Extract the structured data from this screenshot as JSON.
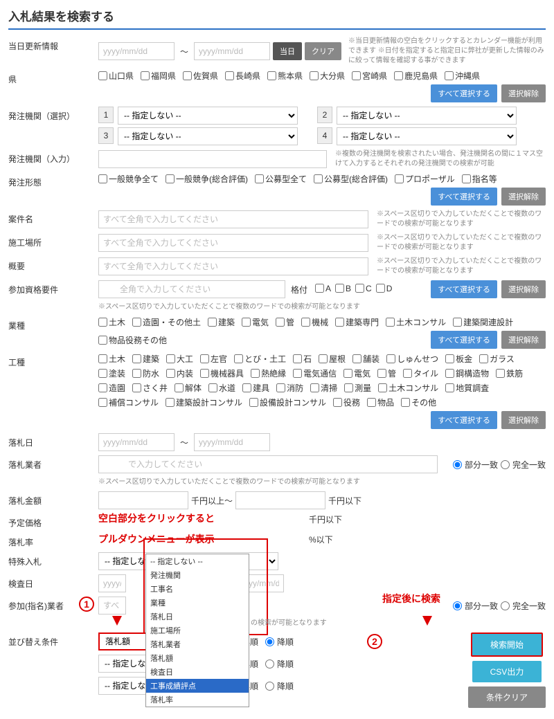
{
  "title": "入札結果を検索する",
  "rows": {
    "update": {
      "label": "当日更新情報",
      "placeholder": "yyyy/mm/dd",
      "btn_today": "当日",
      "btn_clear": "クリア",
      "note": "※当日更新情報の空白をクリックするとカレンダー機能が利用できます\n※日付を指定すると指定日に弊社が更新した情報のみに絞って情報を確認する事ができます"
    },
    "pref": {
      "label": "県",
      "items": [
        "山口県",
        "福岡県",
        "佐賀県",
        "長崎県",
        "熊本県",
        "大分県",
        "宮崎県",
        "鹿児島県",
        "沖縄県"
      ],
      "btn_all": "すべて選択する",
      "btn_clear": "選択解除"
    },
    "org_sel": {
      "label": "発注機関（選択）",
      "placeholder": "-- 指定しない --",
      "nums": [
        "1",
        "2",
        "3",
        "4"
      ]
    },
    "org_input": {
      "label": "発注機関（入力）",
      "note": "※複数の発注機関を検索されたい場合、発注機関名の間に１マス空けて入力するとそれぞれの発注機関での検索が可能"
    },
    "bid_type": {
      "label": "発注形態",
      "items": [
        "一般競争全て",
        "一般競争(総合評価)",
        "公募型全て",
        "公募型(総合評価)",
        "プロポーザル",
        "指名等"
      ],
      "btn_all": "すべて選択する",
      "btn_clear": "選択解除"
    },
    "name": {
      "label": "案件名",
      "placeholder": "すべて全角で入力してください",
      "note": "※スペース区切りで入力していただくことで複数のワードでの検索が可能となります"
    },
    "place": {
      "label": "施工場所",
      "placeholder": "すべて全角で入力してください",
      "note": "※スペース区切りで入力していただくことで複数のワードでの検索が可能となります"
    },
    "summary": {
      "label": "概要",
      "placeholder": "すべて全角で入力してください",
      "note": "※スペース区切りで入力していただくことで複数のワードでの検索が可能となります"
    },
    "qual": {
      "label": "参加資格要件",
      "placeholder": "　　全角で入力してください",
      "grade_label": "格付",
      "grades": [
        "A",
        "B",
        "C",
        "D"
      ],
      "btn_all": "すべて選択する",
      "btn_clear": "選択解除",
      "note": "※スペース区切りで入力していただくことで複数のワードでの検索が可能となります"
    },
    "industry": {
      "label": "業種",
      "items": [
        "土木",
        "造園・その他土",
        "建築",
        "電気",
        "管",
        "機械",
        "建築専門",
        "土木コンサル",
        "建築関連設計",
        "物品役務その他"
      ],
      "btn_all": "すべて選択する",
      "btn_clear": "選択解除"
    },
    "work": {
      "label": "工種",
      "items": [
        "土木",
        "建築",
        "大工",
        "左官",
        "とび・土工",
        "石",
        "屋根",
        "舗装",
        "しゅんせつ",
        "板金",
        "ガラス",
        "塗装",
        "防水",
        "内装",
        "機械器具",
        "熱絶縁",
        "電気通信",
        "電気",
        "管",
        "タイル",
        "鋼構造物",
        "鉄筋",
        "造園",
        "さく井",
        "解体",
        "水道",
        "建具",
        "消防",
        "清掃",
        "測量",
        "土木コンサル",
        "地質調査",
        "補償コンサル",
        "建築設計コンサル",
        "設備設計コンサル",
        "役務",
        "物品",
        "その他"
      ],
      "btn_all": "すべて選択する",
      "btn_clear": "選択解除"
    },
    "award_date": {
      "label": "落札日",
      "placeholder": "yyyy/mm/dd"
    },
    "award_co": {
      "label": "落札業者",
      "placeholder": "　　　で入力してください",
      "partial": "部分一致",
      "exact": "完全一致",
      "note": "※スペース区切りで入力していただくことで複数のワードでの検索が可能となります"
    },
    "award_amt": {
      "label": "落札金額",
      "unit1": "千円以上～",
      "unit2": "千円以下"
    },
    "est_price": {
      "label": "予定価格",
      "unit2": "千円以下"
    },
    "award_rate": {
      "label": "落札率",
      "unit": "%以下"
    },
    "special": {
      "label": "特殊入札",
      "placeholder": "-- 指定しない --"
    },
    "inspect": {
      "label": "検査日",
      "placeholder": "yyyy/mm/dd"
    },
    "participant": {
      "label": "参加(指名)業者",
      "placeholder": "すべ",
      "partial": "部分一致",
      "exact": "完全一致",
      "note2": "の検索が可能となります"
    },
    "sort": {
      "label": "並び替え条件",
      "sel1": "落札額",
      "placeholder": "-- 指定しない --",
      "asc": "昇順",
      "desc": "降順"
    }
  },
  "dropdown": {
    "items": [
      "-- 指定しない --",
      "発注機関",
      "工事名",
      "業種",
      "落札日",
      "施工場所",
      "落札業者",
      "落札額",
      "検査日",
      "工事成績評点",
      "落札率"
    ],
    "selected": "工事成績評点"
  },
  "annotations": {
    "pulldown": "空白部分をクリックすると\nプルルダウンメニューが表示",
    "pulldown1": "空白部分をクリックすると",
    "pulldown2": "プルダウンメニューが表示",
    "after": "指定後に検索",
    "n1": "1",
    "n2": "2"
  },
  "actions": {
    "search": "検索開始",
    "csv": "CSV出力",
    "clear": "条件クリア"
  }
}
